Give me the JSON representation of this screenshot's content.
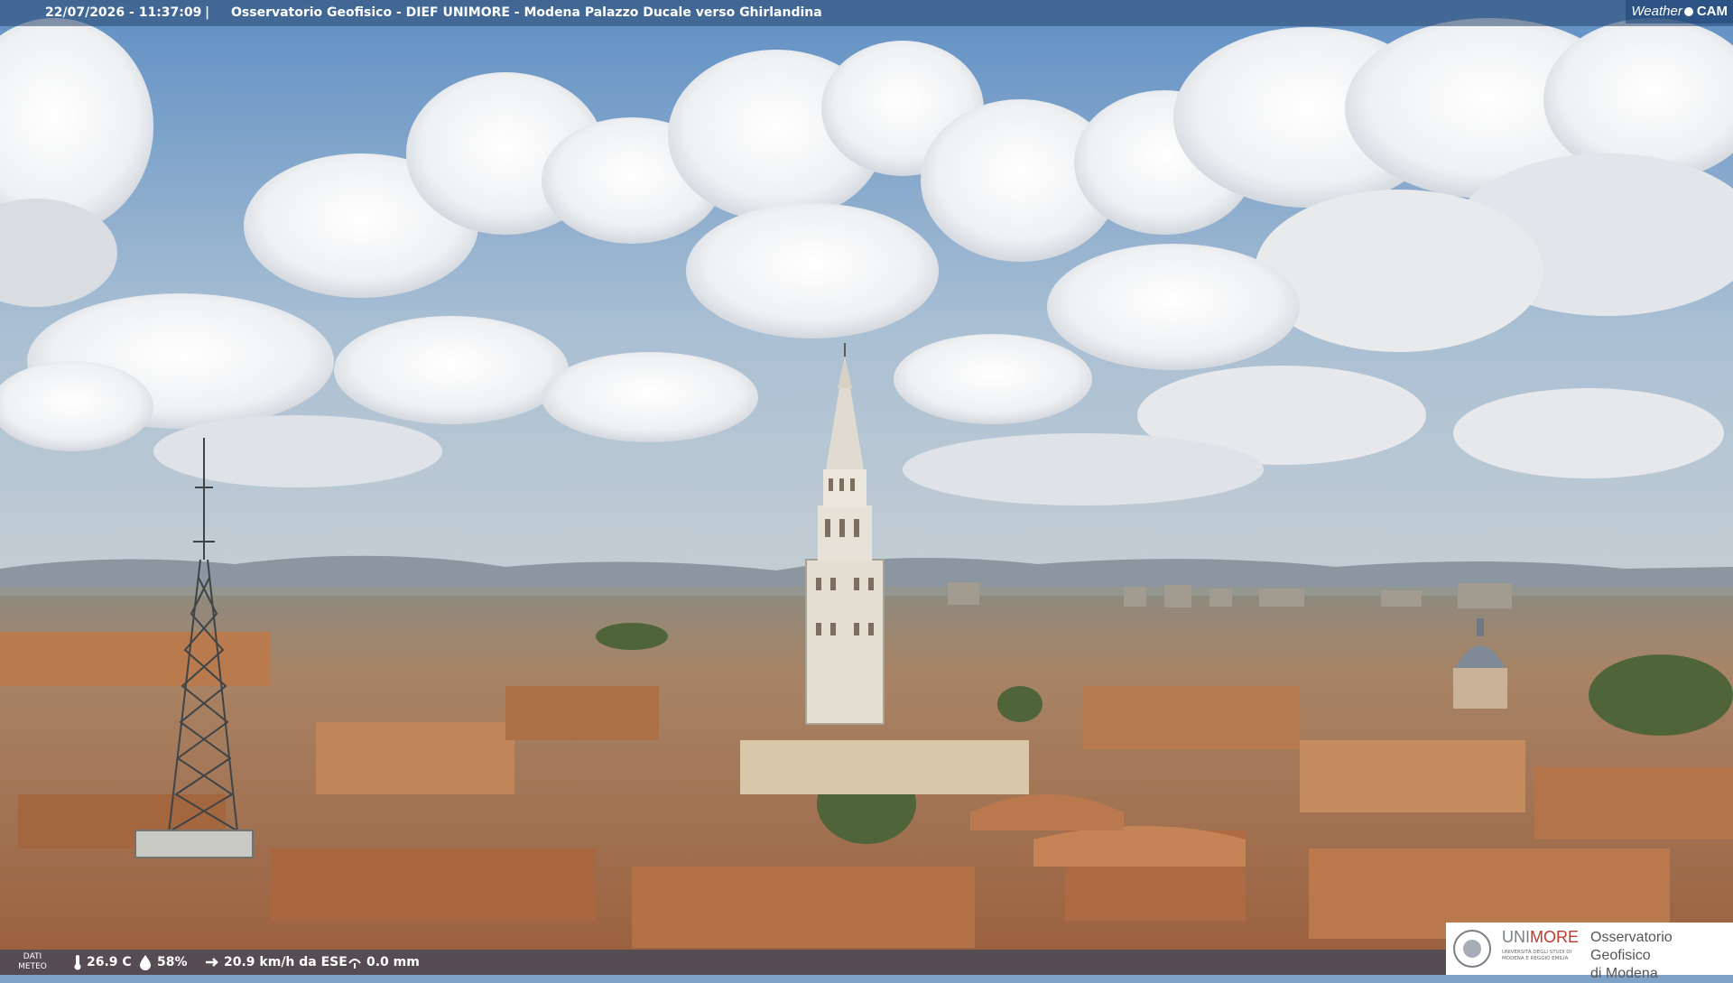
{
  "header": {
    "timestamp": "22/07/2026 - 11:37:09",
    "separator": "|",
    "title": "Osservatorio Geofisico - DIEF UNIMORE - Modena Palazzo Ducale verso Ghirlandina",
    "brand_left": "Weather",
    "brand_right": "CAM"
  },
  "weather": {
    "label_line1": "DATI",
    "label_line2": "METEO",
    "temperature": "26.9 C",
    "humidity": "58%",
    "wind": "20.9 km/h da ESE",
    "rain": "0.0 mm",
    "icons": [
      "thermometer-icon",
      "humidity-icon",
      "wind-icon",
      "rain-icon"
    ]
  },
  "logo": {
    "name_part1": "UNI",
    "name_part2": "MORE",
    "subtitle": "UNIVERSITÀ DEGLI STUDI DI MODENA E REGGIO EMILIA",
    "observatory_line1": "Osservatorio Geofisico",
    "observatory_line2": "di Modena"
  },
  "colors": {
    "sky_top": "#5f8fc4",
    "sky_bottom": "#bcc9d3",
    "roof": "#b2764c",
    "tower": "#e6e1d6",
    "accent_red": "#c0392b"
  }
}
